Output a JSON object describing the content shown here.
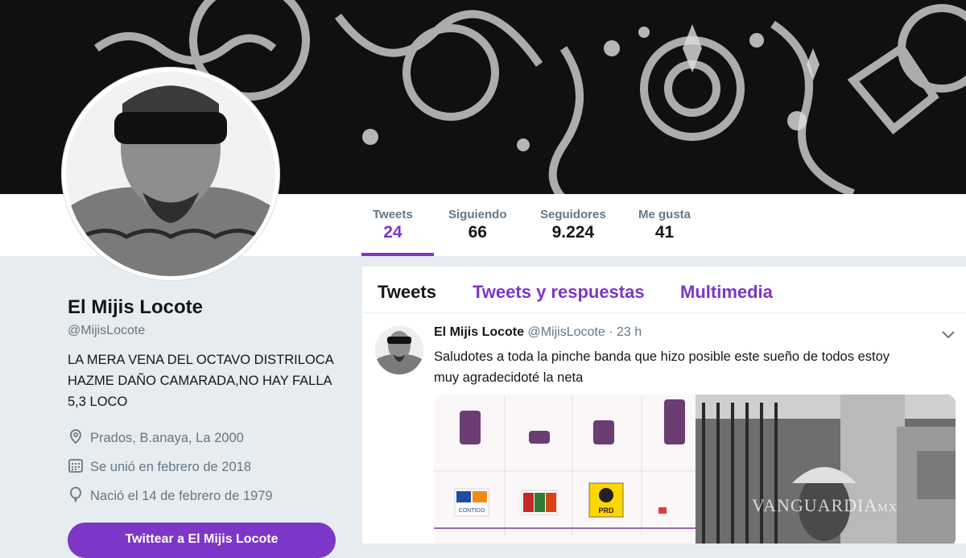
{
  "profile": {
    "name": "El Mijis Locote",
    "handle": "@MijisLocote",
    "bio": "LA MERA VENA DEL OCTAVO DISTRILOCA HAZME DAÑO CAMARADA,NO HAY FALLA 5,3 LOCO",
    "location": "Prados, B.anaya, La 2000",
    "joined": "Se unió en febrero de 2018",
    "birthday": "Nació el 14 de febrero de 1979",
    "tweet_button": "Twittear a El Mijis Locote"
  },
  "stats": [
    {
      "label": "Tweets",
      "value": "24"
    },
    {
      "label": "Siguiendo",
      "value": "66"
    },
    {
      "label": "Seguidores",
      "value": "9.224"
    },
    {
      "label": "Me gusta",
      "value": "41"
    }
  ],
  "tabs": [
    "Tweets",
    "Tweets y respuestas",
    "Multimedia"
  ],
  "tweet": {
    "name": "El Mijis Locote",
    "handle": "@MijisLocote",
    "time": "· 23 h",
    "text": "Saludotes a toda la pinche banda que hizo posible este sueño de todos estoy muy agradecidoté la neta"
  },
  "media": {
    "party_labels": [
      "CONTIGO",
      "PRD"
    ],
    "watermark": "VANGUARDIA",
    "watermark_suffix": "MX"
  },
  "colors": {
    "accent": "#7d36c8",
    "text": "#14171a",
    "muted": "#657786",
    "background": "#e6ecf0"
  },
  "icons": [
    "location-pin-icon",
    "calendar-icon",
    "balloon-icon",
    "chevron-down-icon"
  ]
}
